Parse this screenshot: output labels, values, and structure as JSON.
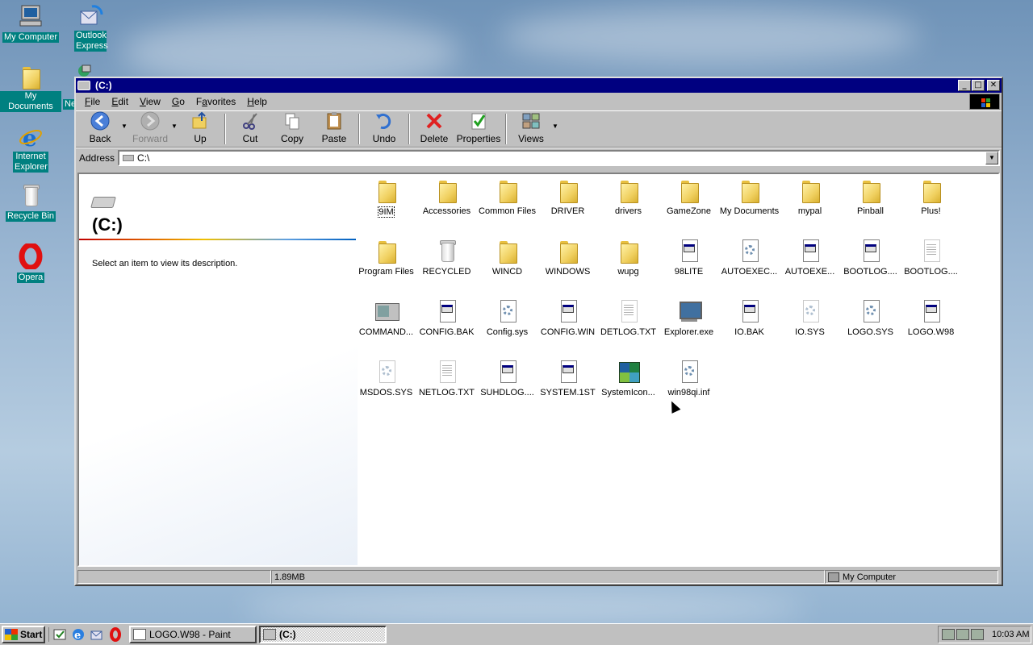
{
  "desktop": {
    "icons": [
      {
        "label": "My Computer"
      },
      {
        "label": "Outlook Express"
      },
      {
        "label": "My Documents"
      },
      {
        "label": "Ne"
      },
      {
        "label": "Internet Explorer"
      },
      {
        "label": "Recycle Bin"
      },
      {
        "label": "Opera"
      }
    ]
  },
  "window": {
    "title": "(C:)",
    "menu": [
      "File",
      "Edit",
      "View",
      "Go",
      "Favorites",
      "Help"
    ],
    "menu_accel": [
      "F",
      "E",
      "V",
      "G",
      "a",
      "H"
    ],
    "toolbar": {
      "back": "Back",
      "forward": "Forward",
      "up": "Up",
      "cut": "Cut",
      "copy": "Copy",
      "paste": "Paste",
      "undo": "Undo",
      "delete": "Delete",
      "properties": "Properties",
      "views": "Views"
    },
    "address": {
      "label": "Address",
      "value": "C:\\"
    },
    "leftpane": {
      "title": "(C:)",
      "description": "Select an item to view its description."
    },
    "files": [
      {
        "name": "9IM",
        "icon": "folder-icon",
        "selected": true
      },
      {
        "name": "Accessories",
        "icon": "folder-icon"
      },
      {
        "name": "Common Files",
        "icon": "folder-icon"
      },
      {
        "name": "DRIVER",
        "icon": "folder-icon"
      },
      {
        "name": "drivers",
        "icon": "folder-icon"
      },
      {
        "name": "GameZone",
        "icon": "folder-icon"
      },
      {
        "name": "My Documents",
        "icon": "folder-icon"
      },
      {
        "name": "mypal",
        "icon": "folder-icon"
      },
      {
        "name": "Pinball",
        "icon": "folder-icon"
      },
      {
        "name": "Plus!",
        "icon": "folder-icon"
      },
      {
        "name": "Program Files",
        "icon": "folder-icon"
      },
      {
        "name": "RECYCLED",
        "icon": "recycle-bin-icon"
      },
      {
        "name": "WINCD",
        "icon": "folder-icon"
      },
      {
        "name": "WINDOWS",
        "icon": "folder-icon"
      },
      {
        "name": "wupg",
        "icon": "folder-icon"
      },
      {
        "name": "98LITE",
        "icon": "program-file-icon"
      },
      {
        "name": "AUTOEXEC...",
        "icon": "settings-file-icon"
      },
      {
        "name": "AUTOEXE...",
        "icon": "program-file-icon"
      },
      {
        "name": "BOOTLOG....",
        "icon": "program-file-icon"
      },
      {
        "name": "BOOTLOG....",
        "icon": "text-file-icon"
      },
      {
        "name": "COMMAND...",
        "icon": "dos-program-icon"
      },
      {
        "name": "CONFIG.BAK",
        "icon": "program-file-icon"
      },
      {
        "name": "Config.sys",
        "icon": "settings-file-icon"
      },
      {
        "name": "CONFIG.WIN",
        "icon": "program-file-icon"
      },
      {
        "name": "DETLOG.TXT",
        "icon": "text-file-icon"
      },
      {
        "name": "Explorer.exe",
        "icon": "computer-program-icon"
      },
      {
        "name": "IO.BAK",
        "icon": "program-file-icon"
      },
      {
        "name": "IO.SYS",
        "icon": "system-file-icon"
      },
      {
        "name": "LOGO.SYS",
        "icon": "settings-file-icon"
      },
      {
        "name": "LOGO.W98",
        "icon": "paint-file-icon"
      },
      {
        "name": "MSDOS.SYS",
        "icon": "system-file-icon"
      },
      {
        "name": "NETLOG.TXT",
        "icon": "text-file-icon"
      },
      {
        "name": "SUHDLOG....",
        "icon": "program-file-icon"
      },
      {
        "name": "SYSTEM.1ST",
        "icon": "program-file-icon"
      },
      {
        "name": "SystemIcon...",
        "icon": "cubes-icon"
      },
      {
        "name": "win98qi.inf",
        "icon": "settings-file-icon"
      }
    ],
    "status": {
      "size": "1.89MB",
      "zone": "My Computer"
    }
  },
  "taskbar": {
    "start": "Start",
    "tasks": [
      {
        "label": "LOGO.W98 - Paint",
        "active": false
      },
      {
        "label": "(C:)",
        "active": true
      }
    ],
    "clock": "10:03 AM"
  }
}
